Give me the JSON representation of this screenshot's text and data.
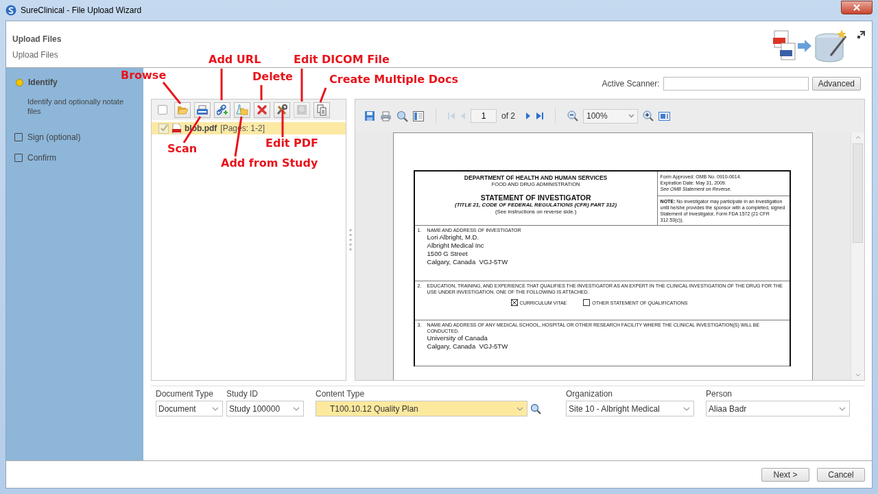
{
  "window": {
    "title": "SureClinical - File Upload Wizard"
  },
  "header": {
    "title": "Upload Files",
    "subtitle": "Upload Files"
  },
  "steps": [
    {
      "label": "Identify",
      "description": "Identify and optionally notate files",
      "selected": true
    },
    {
      "label": "Sign (optional)",
      "selected": false
    },
    {
      "label": "Confirm",
      "selected": false
    }
  ],
  "scanner": {
    "label": "Active Scanner:",
    "button": "Advanced"
  },
  "file_panel": {
    "select_all_checked": false,
    "tools": [
      {
        "kind": "browse",
        "disabled": false
      },
      {
        "kind": "scan",
        "disabled": false
      },
      {
        "kind": "add_url",
        "disabled": false
      },
      {
        "kind": "add_from_study",
        "disabled": false
      },
      {
        "kind": "delete",
        "disabled": false
      },
      {
        "kind": "edit_pdf",
        "disabled": false
      },
      {
        "kind": "edit_dicom",
        "disabled": true
      },
      {
        "kind": "multiple_docs",
        "disabled": false
      }
    ],
    "files": [
      {
        "name": "blob.pdf",
        "pages": "[Pages: 1-2]",
        "selected": true,
        "checked": true
      }
    ]
  },
  "viewer": {
    "page": "1",
    "page_count": "of 2",
    "zoom": "100%",
    "first_disabled": true,
    "prev_disabled": true
  },
  "document": {
    "agency": "DEPARTMENT OF HEALTH AND HUMAN SERVICES",
    "sub_agency": "FOOD AND DRUG ADMINISTRATION",
    "title": "STATEMENT OF INVESTIGATOR",
    "regulation": "(TITLE 21, CODE OF FEDERAL REGULATIONS (CFR) PART 312)",
    "instructions": "(See instructions on reverse side.)",
    "approval": "Form Approved: OMB No. 0910-0014.",
    "expiration": "Expiration Date: May 31, 2009.",
    "omb_note": "See OMB Statement on Reverse.",
    "note": "**NOTE:** No investigator may participate in an investigation until he/she provides the sponsor with a completed, signed Statement of Investigator, Form FDA 1572 (21 CFR 312.53(c)).",
    "sections": [
      {
        "number": "1.",
        "heading": "NAME AND ADDRESS OF INVESTIGATOR",
        "lines": [
          "Lori Albright, M.D.",
          "Albright Medical Inc",
          "1500 G Street",
          "Calgary, Canada  VGJ-5TW"
        ]
      },
      {
        "number": "2.",
        "heading": "EDUCATION, TRAINING, AND EXPERIENCE THAT QUALIFIES THE INVESTIGATOR AS AN EXPERT IN THE CLINICAL INVESTIGATION OF THE DRUG FOR THE USE UNDER INVESTIGATION. ONE OF THE FOLLOWING IS ATTACHED.",
        "options": [
          {
            "label": "CURRICULUM VITAE",
            "checked": true
          },
          {
            "label": "OTHER STATEMENT OF QUALIFICATIONS",
            "checked": false
          }
        ]
      },
      {
        "number": "3.",
        "heading": "NAME AND ADDRESS OF ANY MEDICAL SCHOOL, HOSPITAL OR OTHER RESEARCH FACILITY WHERE THE CLINICAL INVESTIGATION(S) WILL BE CONDUCTED.",
        "lines": [
          "University of Canada",
          "Calgary, Canada  VGJ-5TW"
        ]
      }
    ]
  },
  "fields": [
    {
      "label": "Document Type",
      "value": "Document",
      "highlighted": false,
      "search": false
    },
    {
      "label": "Study ID",
      "value": "Study 100000",
      "highlighted": false,
      "search": false
    },
    {
      "label": "Content Type",
      "value": "T100.10.12 Quality Plan",
      "highlighted": true,
      "search": true
    },
    {
      "label": "Organization",
      "value": "Site 10 - Albright Medical",
      "highlighted": false,
      "search": false
    },
    {
      "label": "Person",
      "value": "Aliaa Badr",
      "highlighted": false,
      "search": false
    }
  ],
  "buttons": [
    {
      "label": "Next >"
    },
    {
      "label": "Cancel"
    }
  ],
  "annotations": [
    "Add URL",
    "Edit DICOM File",
    "Browse",
    "Delete",
    "Create Multiple Docs",
    "Edit PDF",
    "Scan",
    "Add from Study"
  ]
}
